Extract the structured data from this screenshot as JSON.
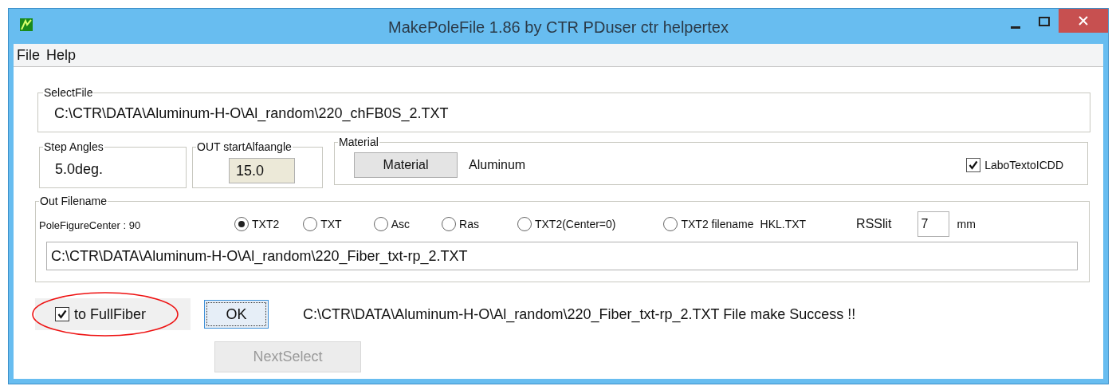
{
  "window": {
    "title": "MakePoleFile 1.86 by CTR PDuser ctr helpertex"
  },
  "menu": [
    "File",
    "Help"
  ],
  "select_file": {
    "label": "SelectFile",
    "path": "C:\\CTR\\DATA\\Aluminum-H-O\\Al_random\\220_chFB0S_2.TXT"
  },
  "step_angles": {
    "label": "Step Angles",
    "value": "5.0deg."
  },
  "out_start": {
    "label": "OUT startAlfaangle",
    "value": "15.0"
  },
  "material": {
    "label": "Material",
    "button": "Material",
    "value": "Aluminum",
    "checkbox": {
      "label": "LaboTextoICDD",
      "checked": true
    }
  },
  "out_filename": {
    "label": "Out Filename",
    "center": "PoleFigureCenter : 90",
    "formats": [
      {
        "label": "TXT2",
        "selected": true
      },
      {
        "label": "TXT",
        "selected": false
      },
      {
        "label": "Asc",
        "selected": false
      },
      {
        "label": "Ras",
        "selected": false
      },
      {
        "label": "TXT2(Center=0)",
        "selected": false
      },
      {
        "label": "TXT2 filename",
        "selected": false
      }
    ],
    "hkl": "HKL.TXT",
    "rsslit_label": "RSSlit",
    "rsslit_value": "7",
    "rsslit_unit": "mm",
    "path": "C:\\CTR\\DATA\\Aluminum-H-O\\Al_random\\220_Fiber_txt-rp_2.TXT"
  },
  "full_fiber": {
    "label": "to FullFiber",
    "checked": true
  },
  "ok_button": "OK",
  "status": "C:\\CTR\\DATA\\Aluminum-H-O\\Al_random\\220_Fiber_txt-rp_2.TXT File make Success !!",
  "next_button": {
    "label": "NextSelect",
    "disabled": true
  }
}
